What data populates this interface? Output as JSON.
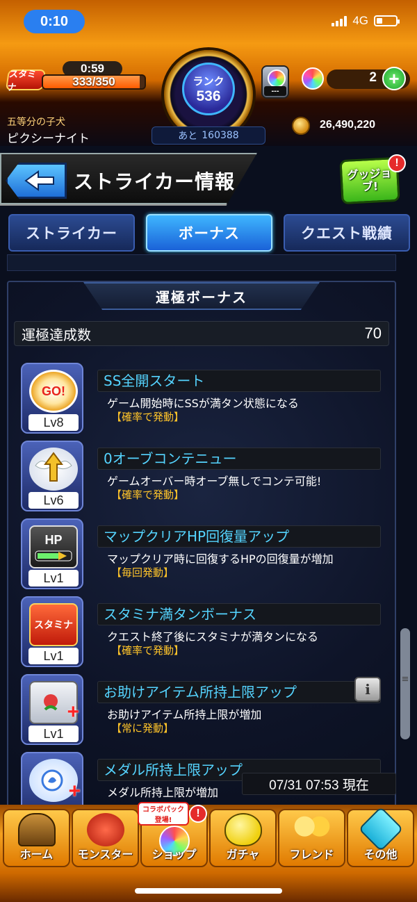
{
  "status_bar": {
    "time": "0:10",
    "network": "4G"
  },
  "header": {
    "stamina_label": "スタミナ",
    "stamina_timer": "0:59",
    "stamina_count": "333/350",
    "stamina_fraction": 0.951,
    "rank_label": "ランク",
    "rank_value": "536",
    "rank_next_prefix": "あと",
    "rank_next_value": "160388",
    "capsule_count": "---",
    "orb_count": "2",
    "orb_add_label": "+",
    "user_title": "五等分の子犬",
    "user_name": "ピクシーナイト",
    "coins": "26,490,220"
  },
  "page": {
    "title": "ストライカー情報",
    "good_job_label": "グッジョブ!",
    "alert_mark": "!"
  },
  "tabs": [
    {
      "label": "ストライカー",
      "active": false
    },
    {
      "label": "ボーナス",
      "active": true
    },
    {
      "label": "クエスト戦績",
      "active": false
    }
  ],
  "panel": {
    "title": "運極ボーナス",
    "count_label": "運極達成数",
    "count_value": "70"
  },
  "bonuses": [
    {
      "icon": "go-burst-icon",
      "icon_text": "GO!",
      "level": "Lv8",
      "name": "SS全開スタート",
      "desc": "ゲーム開始時にSSが満タン状態になる",
      "trigger": "【確率で発動】"
    },
    {
      "icon": "winged-arrow-icon",
      "icon_text": "",
      "level": "Lv6",
      "name": "0オーブコンテニュー",
      "desc": "ゲームオーバー時オーブ無しでコンテ可能!",
      "trigger": "【確率で発動】"
    },
    {
      "icon": "hp-gauge-icon",
      "icon_text": "HP",
      "level": "Lv1",
      "name": "マップクリアHP回復量アップ",
      "desc": "マップクリア時に回復するHPの回復量が増加",
      "trigger": "【毎回発動】"
    },
    {
      "icon": "stamina-gauge-icon",
      "icon_text": "スタミナ",
      "level": "Lv1",
      "name": "スタミナ満タンボーナス",
      "desc": "クエスト終了後にスタミナが満タンになる",
      "trigger": "【確率で発動】"
    },
    {
      "icon": "helper-item-plus-icon",
      "icon_text": "",
      "level": "Lv1",
      "name": "お助けアイテム所持上限アップ",
      "desc": "お助けアイテム所持上限が増加",
      "trigger": "【常に発動】",
      "info": "i"
    },
    {
      "icon": "medal-plus-icon",
      "icon_text": "",
      "level": "",
      "name": "メダル所持上限アップ",
      "desc": "メダル所持上限が増加",
      "trigger": ""
    }
  ],
  "timestamp": "07/31 07:53 現在",
  "nav": {
    "items": [
      {
        "label": "ホーム",
        "icon": "home-gate-icon"
      },
      {
        "label": "モンスター",
        "icon": "monster-dragon-icon"
      },
      {
        "label": "ショップ",
        "icon": "shop-orb-icon"
      },
      {
        "label": "ガチャ",
        "icon": "gacha-egg-icon"
      },
      {
        "label": "フレンド",
        "icon": "friend-balloons-icon"
      },
      {
        "label": "その他",
        "icon": "other-menu-icon"
      }
    ],
    "collab_badge_line1": "コラボパック",
    "collab_badge_line2": "登場!",
    "shop_alert": "!"
  },
  "colors": {
    "header_orange": "#f59a12",
    "tab_active": "#3fb6ff",
    "bonus_name": "#55d4ff",
    "trigger_yellow": "#ffc42a"
  }
}
